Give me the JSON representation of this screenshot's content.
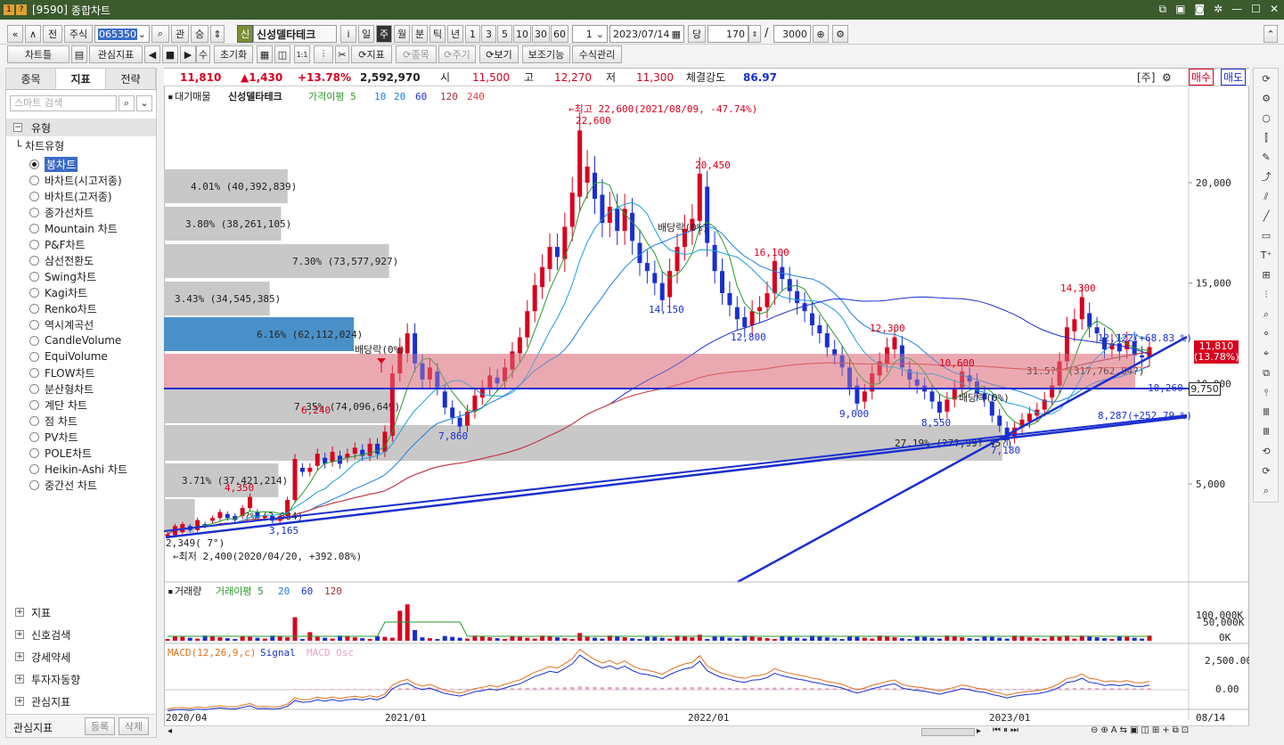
{
  "window": {
    "code": "[9590]",
    "title": "종합차트"
  },
  "toolbar1": {
    "nav_first": "«",
    "nav_up": "∧",
    "prev": "전",
    "market": "주식",
    "code": "065350",
    "search": "⌕",
    "gwan": "관",
    "sang": "승",
    "badge": "신",
    "stock_name": "신성델타테크",
    "info": "i",
    "periods": [
      "일",
      "주",
      "월",
      "분",
      "틱",
      "년"
    ],
    "active_period": "주",
    "nums": [
      "1",
      "3",
      "5",
      "10",
      "30",
      "60"
    ],
    "count_sel": "1",
    "date": "2023/07/14",
    "dang": "당",
    "shown": "170",
    "sep": "/",
    "total": "3000"
  },
  "toolbar2": {
    "chart_tool": "차트틀",
    "favorites": "관심지표",
    "su": "수",
    "reset": "초기화",
    "indicator": "지표",
    "stocks": "종목",
    "cycle": "주기",
    "view": "보기",
    "aux": "보조기능",
    "formula": "수식관리"
  },
  "left": {
    "tabs": [
      "종목",
      "지표",
      "전략"
    ],
    "active_tab": "지표",
    "search_placeholder": "스마트 검색",
    "root": "유형",
    "group": "차트유형",
    "items": [
      "봉차트",
      "바차트(시고저종)",
      "바차트(고저종)",
      "종가선차트",
      "Mountain 차트",
      "P&F차트",
      "삼선전환도",
      "Swing차트",
      "Kagi차트",
      "Renko차트",
      "역시계곡선",
      "CandleVolume",
      "EquiVolume",
      "FLOW차트",
      "분산형차트",
      "계단 차트",
      "점 차트",
      "PV차트",
      "POLE차트",
      "Heikin-Ashi 차트",
      "중간선 차트"
    ],
    "sections": [
      "지표",
      "신호검색",
      "강세약세",
      "투자자동향",
      "관심지표"
    ],
    "footer_label": "관심지표",
    "register": "등록",
    "delete": "삭제"
  },
  "infobar": {
    "price": "11,810",
    "change": "▲1,430",
    "pct": "+13.78%",
    "volume": "2,592,970",
    "open_l": "시",
    "open": "11,500",
    "high_l": "고",
    "high": "12,270",
    "low_l": "저",
    "low": "11,300",
    "strength_l": "체결강도",
    "strength": "86.97",
    "ju": "[주]",
    "buy": "매수",
    "sell": "매도"
  },
  "colors": {
    "up": "#d8001f",
    "down": "#1a2fcf",
    "accent": "#3b5a2e"
  },
  "chart_data": {
    "type": "candlestick",
    "legend": [
      "대기매물",
      "신성델타테크",
      "가격이평 5",
      "10",
      "20",
      "60",
      "120",
      "240"
    ],
    "y_ticks": [
      "20,000",
      "15,000",
      "10,000",
      "5,000"
    ],
    "x_ticks": [
      "2020/04",
      "2021/01",
      "2022/01",
      "2023/01",
      "08/14"
    ],
    "annotations": [
      "←최고 22,600(2021/08/09, -47.74%)",
      "22,600",
      "20,450",
      "16,100",
      "14,150",
      "12,800",
      "12,300",
      "10,600",
      "9,000",
      "8,550",
      "7,860",
      "7,180",
      "14,300",
      "6,240",
      "4,350",
      "3,165",
      "2,349( 7°)",
      "←최저 2,400(2020/04/20, +392.08%)",
      "배당락(0%)",
      "배당락(0%)",
      "배당락(0%)",
      "12,122(+68.83 %)",
      "8,287(+252.79 %)",
      "10,260"
    ],
    "volume_bars": [
      {
        "label": "4.01% (40,392,839)",
        "pct": 4.01
      },
      {
        "label": "3.80% (38,261,105)",
        "pct": 3.8
      },
      {
        "label": "7.30% (73,577,927)",
        "pct": 7.3
      },
      {
        "label": "3.43% (34,545,385)",
        "pct": 3.43
      },
      {
        "label": "6.16% (62,112,024)",
        "pct": 6.16
      },
      {
        "label": "31.5?% (317,762,84?)",
        "pct": 31.5
      },
      {
        "label": "7.35% (74,096,649)",
        "pct": 7.35
      },
      {
        "label": "27.19% (27?,99?,45?)",
        "pct": 27.19
      },
      {
        "label": "3.71% (37,421,214)",
        "pct": 3.71
      },
      {
        "label": "?% (?,884)",
        "pct": 1.0
      }
    ],
    "price_tag": "11,810",
    "price_tag_pct": "(13.78%)",
    "cross_price": "9,750",
    "volume_panel": {
      "legend": [
        "거래량",
        "거래이평 5",
        "20",
        "60",
        "120"
      ],
      "ticks": [
        "100,000K",
        "50,000K",
        "0K"
      ]
    },
    "macd_panel": {
      "legend": [
        "MACD(12,26,9,c)",
        "Signal",
        "MACD Osc"
      ],
      "ticks": [
        "2,500.00",
        "0.00"
      ]
    }
  }
}
